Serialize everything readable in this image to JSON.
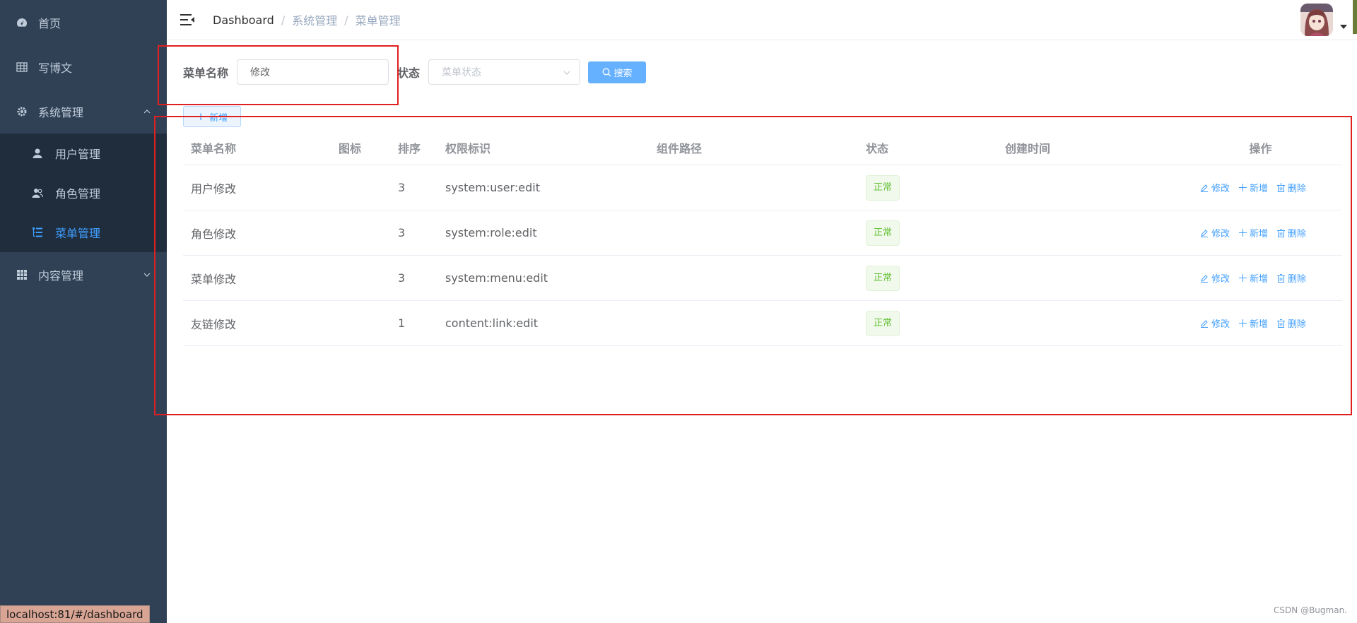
{
  "sidebar": {
    "items": [
      {
        "label": "首页",
        "icon": "dashboard-icon"
      },
      {
        "label": "写博文",
        "icon": "table-icon"
      },
      {
        "label": "系统管理",
        "icon": "gear-icon",
        "expanded": true,
        "children": [
          {
            "label": "用户管理",
            "icon": "user-icon"
          },
          {
            "label": "角色管理",
            "icon": "peoples-icon"
          },
          {
            "label": "菜单管理",
            "icon": "tree-table-icon",
            "active": true
          }
        ]
      },
      {
        "label": "内容管理",
        "icon": "grid-icon",
        "expanded": false
      }
    ],
    "bg_color": "#304156",
    "active_color": "#409eff"
  },
  "header": {
    "breadcrumb": [
      "Dashboard",
      "系统管理",
      "菜单管理"
    ],
    "separator": "/"
  },
  "search": {
    "name_label": "菜单名称",
    "name_value": "修改",
    "status_label": "状态",
    "status_placeholder": "菜单状态",
    "search_button": "搜索"
  },
  "toolbar": {
    "add_button": "新增"
  },
  "table": {
    "columns": [
      "菜单名称",
      "图标",
      "排序",
      "权限标识",
      "组件路径",
      "状态",
      "创建时间",
      "操作"
    ],
    "rows": [
      {
        "name": "用户修改",
        "icon": "",
        "order": "3",
        "perms": "system:user:edit",
        "component": "",
        "status": "正常",
        "created": ""
      },
      {
        "name": "角色修改",
        "icon": "",
        "order": "3",
        "perms": "system:role:edit",
        "component": "",
        "status": "正常",
        "created": ""
      },
      {
        "name": "菜单修改",
        "icon": "",
        "order": "3",
        "perms": "system:menu:edit",
        "component": "",
        "status": "正常",
        "created": ""
      },
      {
        "name": "友链修改",
        "icon": "",
        "order": "1",
        "perms": "content:link:edit",
        "component": "",
        "status": "正常",
        "created": ""
      }
    ],
    "actions": {
      "edit": "修改",
      "add": "新增",
      "delete": "删除"
    }
  },
  "status_bar": "localhost:81/#/dashboard",
  "watermark": "CSDN @Bugman.",
  "colors": {
    "primary": "#409eff",
    "success": "#67c23a",
    "highlight": "#e02020"
  }
}
